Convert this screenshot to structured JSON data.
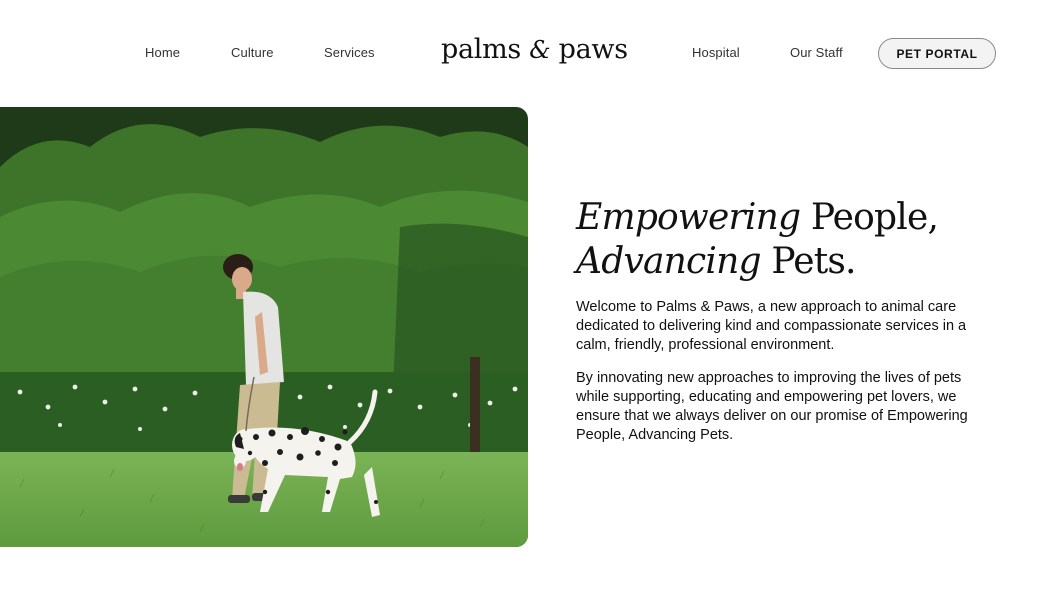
{
  "nav": {
    "left": [
      "Home",
      "Culture",
      "Services"
    ],
    "right": [
      "Hospital",
      "Our Staff"
    ],
    "portal_label": "PET PORTAL"
  },
  "logo": {
    "word1": "palms",
    "amp": "&",
    "word2": "paws"
  },
  "hero": {
    "image_alt": "Man walking a dalmatian on grass in front of hedges",
    "headline_line1_italic": "Empowering",
    "headline_line1_rest": " People,",
    "headline_line2_italic": "Advancing",
    "headline_line2_rest": " Pets.",
    "paragraph1": "Welcome to Palms & Paws, a new approach to animal care dedicated to delivering kind and compassionate services in a calm, friendly, professional environment.",
    "paragraph2": "By innovating new approaches to improving the lives of pets while supporting, educating and empowering pet lovers, we ensure that we always deliver on our promise of Empowering People, Advancing Pets."
  },
  "colors": {
    "text": "#111111",
    "button_bg": "#f3f3f3",
    "button_border": "#8a8a8a",
    "hedge": "#3f7a2e",
    "lawn": "#6aa84a"
  }
}
